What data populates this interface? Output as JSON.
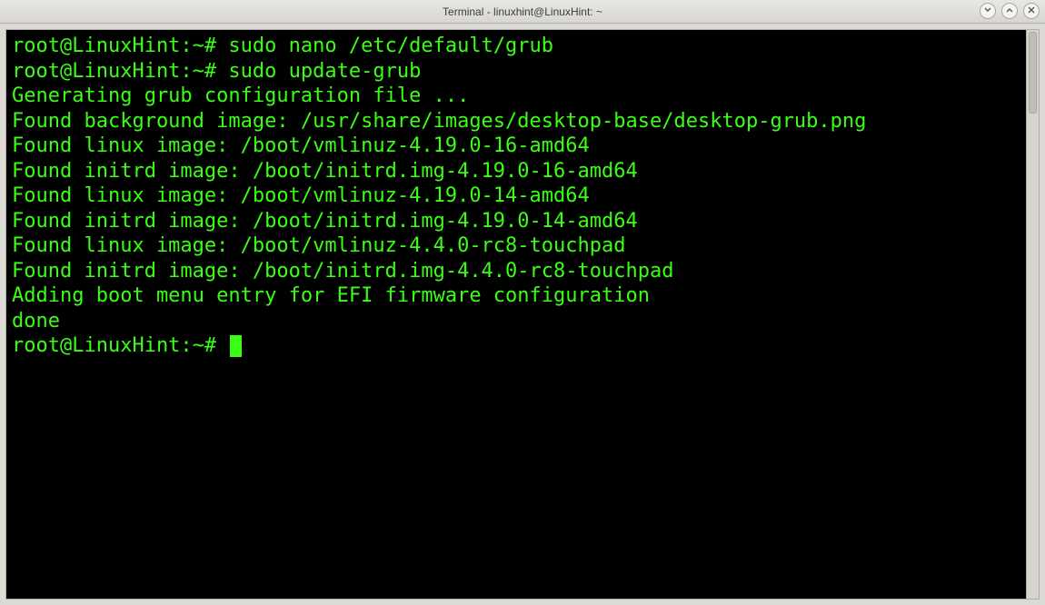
{
  "window": {
    "title": "Terminal - linuxhint@LinuxHint: ~"
  },
  "terminal": {
    "prompt": "root@LinuxHint:~#",
    "lines": [
      {
        "prompt": "root@LinuxHint:~#",
        "cmd": "sudo nano /etc/default/grub"
      },
      {
        "prompt": "root@LinuxHint:~#",
        "cmd": "sudo update-grub"
      },
      {
        "out": "Generating grub configuration file ..."
      },
      {
        "out": "Found background image: /usr/share/images/desktop-base/desktop-grub.png"
      },
      {
        "out": "Found linux image: /boot/vmlinuz-4.19.0-16-amd64"
      },
      {
        "out": "Found initrd image: /boot/initrd.img-4.19.0-16-amd64"
      },
      {
        "out": "Found linux image: /boot/vmlinuz-4.19.0-14-amd64"
      },
      {
        "out": "Found initrd image: /boot/initrd.img-4.19.0-14-amd64"
      },
      {
        "out": "Found linux image: /boot/vmlinuz-4.4.0-rc8-touchpad"
      },
      {
        "out": "Found initrd image: /boot/initrd.img-4.4.0-rc8-touchpad"
      },
      {
        "out": "Adding boot menu entry for EFI firmware configuration"
      },
      {
        "out": "done"
      },
      {
        "prompt": "root@LinuxHint:~#",
        "cmd": "",
        "cursor": true
      }
    ]
  }
}
